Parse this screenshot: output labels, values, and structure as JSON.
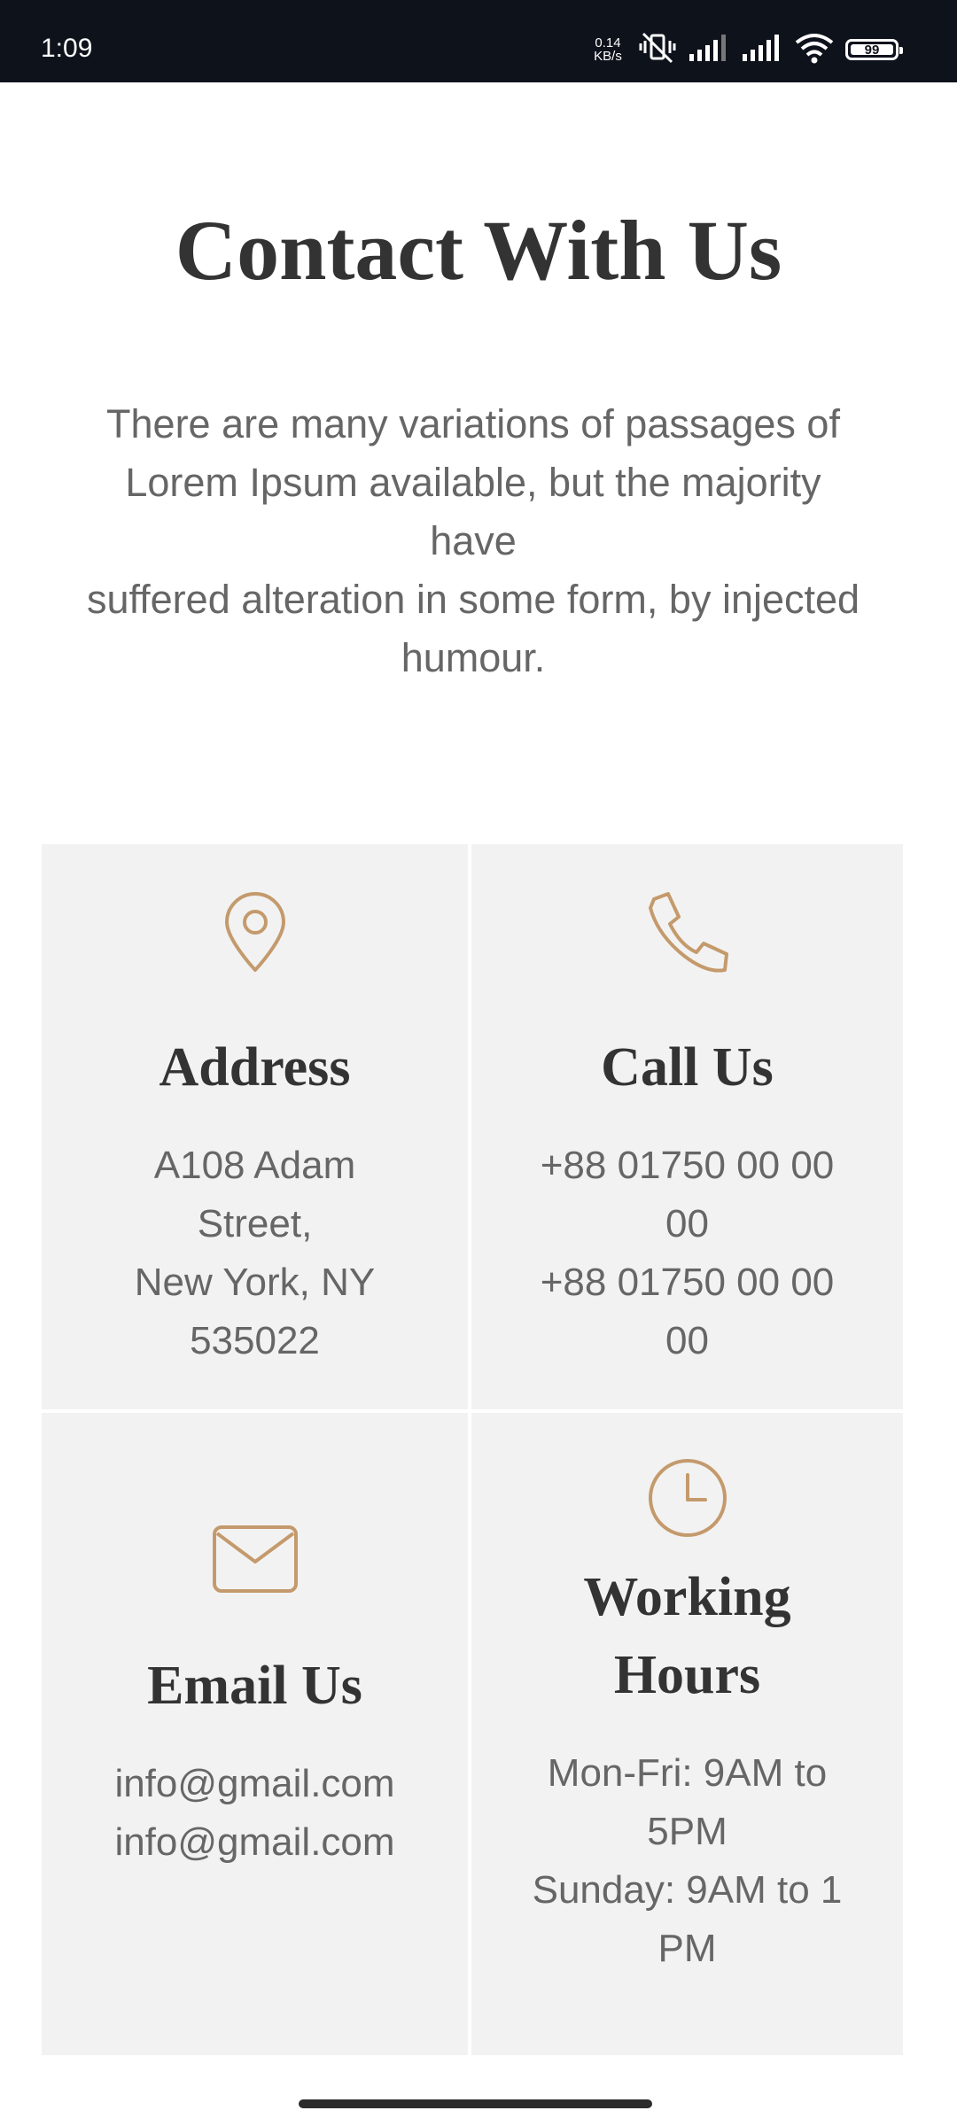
{
  "status_bar": {
    "time": "1:09",
    "net_speed_value": "0.14",
    "net_speed_unit": "KB/s",
    "battery": "99"
  },
  "page": {
    "title": "Contact With Us",
    "intro_lines": [
      "There are many variations of passages of",
      "Lorem Ipsum available, but the majority",
      "have",
      "suffered alteration in some form, by injected",
      "humour."
    ]
  },
  "cards": {
    "address": {
      "icon": "location-pin-icon",
      "title": "Address",
      "lines": [
        "A108 Adam",
        "Street,",
        "New York, NY",
        "535022"
      ]
    },
    "call": {
      "icon": "phone-icon",
      "title": "Call Us",
      "lines": [
        "+88 01750 00 00",
        "00",
        "+88 01750 00 00",
        "00"
      ]
    },
    "email": {
      "icon": "envelope-icon",
      "title": "Email Us",
      "lines": [
        "info@gmail.com",
        "info@gmail.com"
      ]
    },
    "hours": {
      "icon": "clock-icon",
      "title_lines": [
        "Working",
        "Hours"
      ],
      "lines": [
        "Mon-Fri: 9AM to",
        "5PM",
        "Sunday: 9AM to 1",
        "PM"
      ]
    }
  },
  "colors": {
    "accent": "#c49a6c",
    "heading": "#333333",
    "body_text": "#666666",
    "card_bg": "#f2f2f2",
    "status_bar_bg": "#0e121b"
  }
}
